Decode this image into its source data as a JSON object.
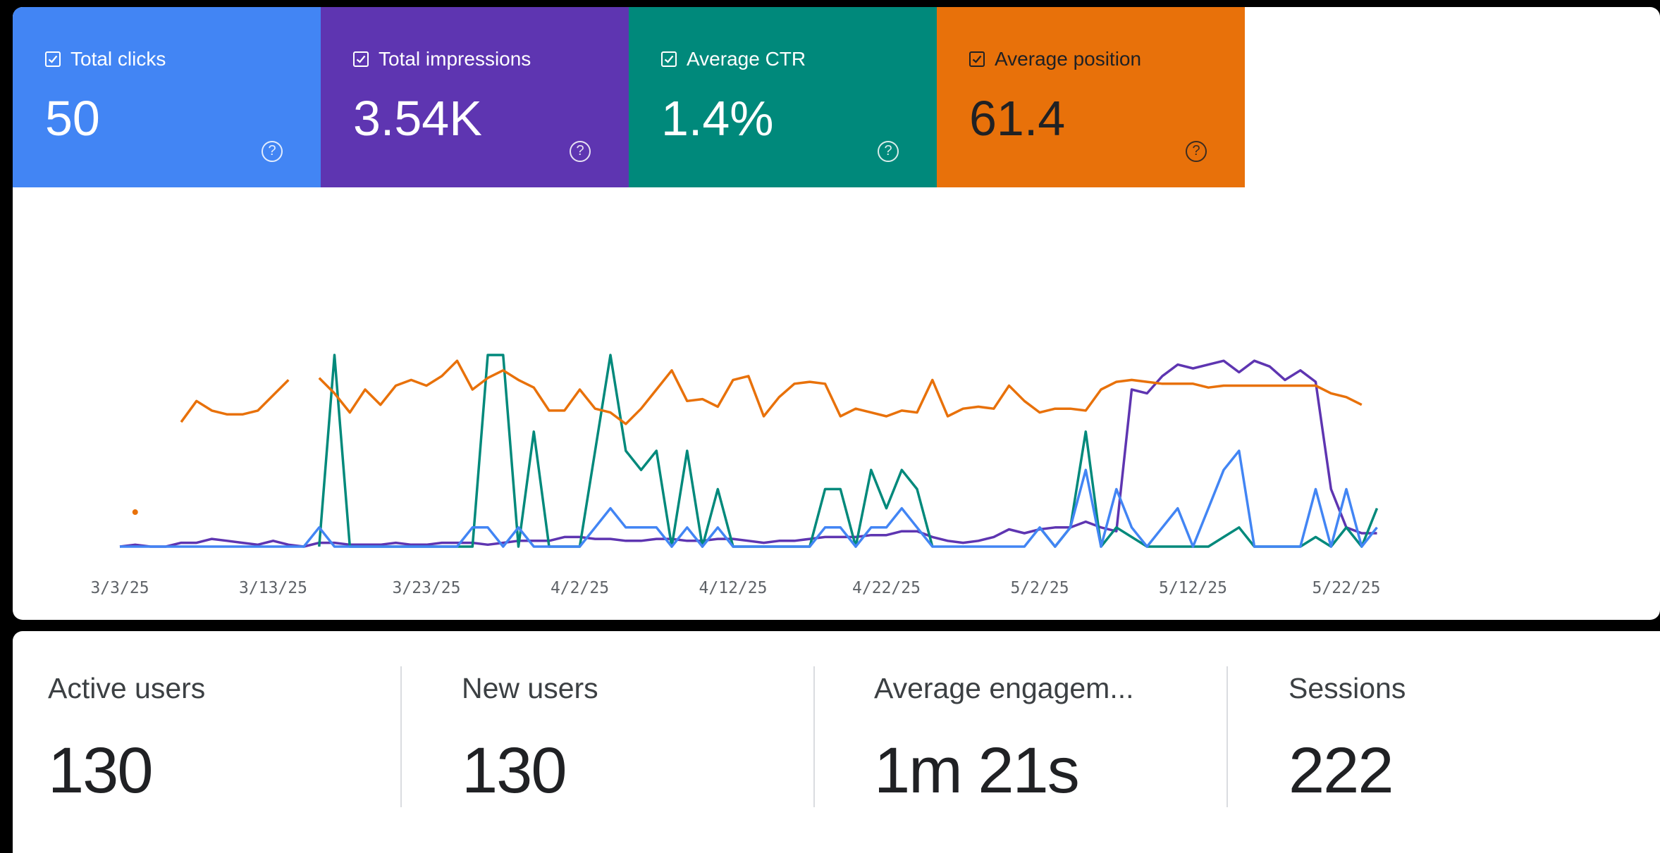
{
  "search_console": {
    "cards": [
      {
        "label": "Total clicks",
        "value": "50",
        "color": "#4285f4",
        "text_color": "#ffffff",
        "checked": true,
        "icon": "help-icon"
      },
      {
        "label": "Total impressions",
        "value": "3.54K",
        "color": "#5e35b1",
        "text_color": "#ffffff",
        "checked": true,
        "icon": "help-icon"
      },
      {
        "label": "Average CTR",
        "value": "1.4%",
        "color": "#00897b",
        "text_color": "#ffffff",
        "checked": true,
        "icon": "help-icon"
      },
      {
        "label": "Average position",
        "value": "61.4",
        "color": "#e8710a",
        "text_color": "#202124",
        "checked": true,
        "icon": "help-icon"
      }
    ]
  },
  "chart_data": {
    "type": "line",
    "x_ticks": [
      "3/3/25",
      "3/13/25",
      "3/23/25",
      "4/2/25",
      "4/12/25",
      "4/22/25",
      "5/2/25",
      "5/12/25",
      "5/22/25"
    ],
    "x_start": "3/3/25",
    "x_end": "5/23/25",
    "grid": false,
    "legend": "none",
    "y_range": [
      0,
      100
    ],
    "series": [
      {
        "key": "clicks",
        "color": "#4285f4",
        "points": [
          [
            0,
            0
          ],
          [
            1,
            0
          ],
          [
            2,
            0
          ],
          [
            3,
            0
          ],
          [
            4,
            0
          ],
          [
            5,
            0
          ],
          [
            6,
            0
          ],
          [
            7,
            0
          ],
          [
            8,
            0
          ],
          [
            9,
            0
          ],
          [
            10,
            0
          ],
          [
            11,
            0
          ],
          [
            12,
            0
          ],
          [
            13,
            10
          ],
          [
            14,
            0
          ],
          [
            15,
            0
          ],
          [
            16,
            0
          ],
          [
            17,
            0
          ],
          [
            18,
            0
          ],
          [
            19,
            0
          ],
          [
            20,
            0
          ],
          [
            21,
            0
          ],
          [
            22,
            0
          ],
          [
            23,
            10
          ],
          [
            24,
            10
          ],
          [
            25,
            0
          ],
          [
            26,
            10
          ],
          [
            27,
            0
          ],
          [
            28,
            0
          ],
          [
            29,
            0
          ],
          [
            30,
            0
          ],
          [
            31,
            10
          ],
          [
            32,
            20
          ],
          [
            33,
            10
          ],
          [
            34,
            10
          ],
          [
            35,
            10
          ],
          [
            36,
            0
          ],
          [
            37,
            10
          ],
          [
            38,
            0
          ],
          [
            39,
            10
          ],
          [
            40,
            0
          ],
          [
            41,
            0
          ],
          [
            42,
            0
          ],
          [
            43,
            0
          ],
          [
            44,
            0
          ],
          [
            45,
            0
          ],
          [
            46,
            10
          ],
          [
            47,
            10
          ],
          [
            48,
            0
          ],
          [
            49,
            10
          ],
          [
            50,
            10
          ],
          [
            51,
            20
          ],
          [
            52,
            10
          ],
          [
            53,
            0
          ],
          [
            54,
            0
          ],
          [
            55,
            0
          ],
          [
            56,
            0
          ],
          [
            57,
            0
          ],
          [
            58,
            0
          ],
          [
            59,
            0
          ],
          [
            60,
            10
          ],
          [
            61,
            0
          ],
          [
            62,
            10
          ],
          [
            63,
            40
          ],
          [
            64,
            0
          ],
          [
            65,
            30
          ],
          [
            66,
            10
          ],
          [
            67,
            0
          ],
          [
            68,
            10
          ],
          [
            69,
            20
          ],
          [
            70,
            0
          ],
          [
            71,
            20
          ],
          [
            72,
            40
          ],
          [
            73,
            50
          ],
          [
            74,
            0
          ],
          [
            75,
            0
          ],
          [
            76,
            0
          ],
          [
            77,
            0
          ],
          [
            78,
            30
          ],
          [
            79,
            0
          ],
          [
            80,
            30
          ],
          [
            81,
            0
          ],
          [
            82,
            10
          ]
        ]
      },
      {
        "key": "impressions",
        "color": "#5e35b1",
        "points": [
          [
            0,
            0
          ],
          [
            1,
            1
          ],
          [
            2,
            0
          ],
          [
            3,
            0
          ],
          [
            4,
            2
          ],
          [
            5,
            2
          ],
          [
            6,
            4
          ],
          [
            7,
            3
          ],
          [
            8,
            2
          ],
          [
            9,
            1
          ],
          [
            10,
            3
          ],
          [
            11,
            1
          ],
          [
            12,
            0
          ],
          [
            13,
            2
          ],
          [
            14,
            2
          ],
          [
            15,
            1
          ],
          [
            16,
            1
          ],
          [
            17,
            1
          ],
          [
            18,
            2
          ],
          [
            19,
            1
          ],
          [
            20,
            1
          ],
          [
            21,
            2
          ],
          [
            22,
            2
          ],
          [
            23,
            2
          ],
          [
            24,
            1
          ],
          [
            25,
            2
          ],
          [
            26,
            3
          ],
          [
            27,
            3
          ],
          [
            28,
            3
          ],
          [
            29,
            5
          ],
          [
            30,
            5
          ],
          [
            31,
            4
          ],
          [
            32,
            4
          ],
          [
            33,
            3
          ],
          [
            34,
            3
          ],
          [
            35,
            4
          ],
          [
            36,
            4
          ],
          [
            37,
            3
          ],
          [
            38,
            3
          ],
          [
            39,
            4
          ],
          [
            40,
            4
          ],
          [
            41,
            3
          ],
          [
            42,
            2
          ],
          [
            43,
            3
          ],
          [
            44,
            3
          ],
          [
            45,
            4
          ],
          [
            46,
            5
          ],
          [
            47,
            5
          ],
          [
            48,
            5
          ],
          [
            49,
            6
          ],
          [
            50,
            6
          ],
          [
            51,
            8
          ],
          [
            52,
            8
          ],
          [
            53,
            5
          ],
          [
            54,
            3
          ],
          [
            55,
            2
          ],
          [
            56,
            3
          ],
          [
            57,
            5
          ],
          [
            58,
            9
          ],
          [
            59,
            7
          ],
          [
            60,
            9
          ],
          [
            61,
            10
          ],
          [
            62,
            10
          ],
          [
            63,
            13
          ],
          [
            64,
            10
          ],
          [
            65,
            8
          ],
          [
            66,
            82
          ],
          [
            67,
            80
          ],
          [
            68,
            89
          ],
          [
            69,
            95
          ],
          [
            70,
            93
          ],
          [
            71,
            95
          ],
          [
            72,
            97
          ],
          [
            73,
            91
          ],
          [
            74,
            97
          ],
          [
            75,
            94
          ],
          [
            76,
            87
          ],
          [
            77,
            92
          ],
          [
            78,
            86
          ],
          [
            79,
            30
          ],
          [
            80,
            10
          ],
          [
            81,
            7
          ],
          [
            82,
            7
          ]
        ]
      },
      {
        "key": "ctr",
        "color": "#00897b",
        "points": [
          [
            13,
            0
          ],
          [
            14,
            100
          ],
          [
            15,
            0
          ],
          [
            16,
            0
          ],
          [
            17,
            0
          ],
          [
            18,
            0
          ],
          [
            19,
            0
          ],
          [
            20,
            0
          ],
          [
            21,
            0
          ],
          [
            22,
            0
          ],
          [
            23,
            0
          ],
          [
            24,
            100
          ],
          [
            25,
            100
          ],
          [
            26,
            0
          ],
          [
            27,
            60
          ],
          [
            28,
            0
          ],
          [
            29,
            0
          ],
          [
            30,
            0
          ],
          [
            31,
            50
          ],
          [
            32,
            100
          ],
          [
            33,
            50
          ],
          [
            34,
            40
          ],
          [
            35,
            50
          ],
          [
            36,
            0
          ],
          [
            37,
            50
          ],
          [
            38,
            0
          ],
          [
            39,
            30
          ],
          [
            40,
            0
          ],
          [
            41,
            0
          ],
          [
            42,
            0
          ],
          [
            43,
            0
          ],
          [
            44,
            0
          ],
          [
            45,
            0
          ],
          [
            46,
            30
          ],
          [
            47,
            30
          ],
          [
            48,
            0
          ],
          [
            49,
            40
          ],
          [
            50,
            20
          ],
          [
            51,
            40
          ],
          [
            52,
            30
          ],
          [
            53,
            0
          ],
          [
            60,
            10
          ],
          [
            61,
            0
          ],
          [
            62,
            10
          ],
          [
            63,
            60
          ],
          [
            64,
            0
          ],
          [
            65,
            10
          ],
          [
            66,
            5
          ],
          [
            67,
            0
          ],
          [
            68,
            0
          ],
          [
            69,
            0
          ],
          [
            70,
            0
          ],
          [
            71,
            0
          ],
          [
            72,
            5
          ],
          [
            73,
            10
          ],
          [
            74,
            0
          ],
          [
            75,
            0
          ],
          [
            76,
            0
          ],
          [
            77,
            0
          ],
          [
            78,
            5
          ],
          [
            79,
            0
          ],
          [
            80,
            10
          ],
          [
            81,
            0
          ],
          [
            82,
            20
          ]
        ]
      },
      {
        "key": "position",
        "color": "#e8710a",
        "points": [
          [
            1,
            18
          ],
          [
            4,
            65
          ],
          [
            5,
            76
          ],
          [
            6,
            71
          ],
          [
            7,
            69
          ],
          [
            8,
            69
          ],
          [
            9,
            71
          ],
          [
            10,
            79
          ],
          [
            11,
            87
          ],
          [
            13,
            88
          ],
          [
            14,
            80
          ],
          [
            15,
            70
          ],
          [
            16,
            82
          ],
          [
            17,
            74
          ],
          [
            18,
            84
          ],
          [
            19,
            87
          ],
          [
            20,
            84
          ],
          [
            21,
            89
          ],
          [
            22,
            97
          ],
          [
            23,
            82
          ],
          [
            24,
            88
          ],
          [
            25,
            92
          ],
          [
            26,
            87
          ],
          [
            27,
            83
          ],
          [
            28,
            71
          ],
          [
            29,
            71
          ],
          [
            30,
            82
          ],
          [
            31,
            72
          ],
          [
            32,
            70
          ],
          [
            33,
            64
          ],
          [
            34,
            72
          ],
          [
            35,
            82
          ],
          [
            36,
            92
          ],
          [
            37,
            76
          ],
          [
            38,
            77
          ],
          [
            39,
            73
          ],
          [
            40,
            87
          ],
          [
            41,
            89
          ],
          [
            42,
            68
          ],
          [
            43,
            78
          ],
          [
            44,
            85
          ],
          [
            45,
            86
          ],
          [
            46,
            85
          ],
          [
            47,
            68
          ],
          [
            48,
            72
          ],
          [
            49,
            70
          ],
          [
            50,
            68
          ],
          [
            51,
            71
          ],
          [
            52,
            70
          ],
          [
            53,
            87
          ],
          [
            54,
            68
          ],
          [
            55,
            72
          ],
          [
            56,
            73
          ],
          [
            57,
            72
          ],
          [
            58,
            84
          ],
          [
            59,
            76
          ],
          [
            60,
            70
          ],
          [
            61,
            72
          ],
          [
            62,
            72
          ],
          [
            63,
            71
          ],
          [
            64,
            82
          ],
          [
            65,
            86
          ],
          [
            66,
            87
          ],
          [
            67,
            86
          ],
          [
            68,
            85
          ],
          [
            69,
            85
          ],
          [
            70,
            85
          ],
          [
            71,
            83
          ],
          [
            72,
            84
          ],
          [
            73,
            84
          ],
          [
            74,
            84
          ],
          [
            75,
            84
          ],
          [
            76,
            84
          ],
          [
            77,
            84
          ],
          [
            78,
            84
          ],
          [
            79,
            80
          ],
          [
            80,
            78
          ],
          [
            81,
            74
          ]
        ]
      }
    ]
  },
  "analytics": {
    "metrics": [
      {
        "label": "Active users",
        "value": "130"
      },
      {
        "label": "New users",
        "value": "130"
      },
      {
        "label": "Average engagem...",
        "value": "1m 21s"
      },
      {
        "label": "Sessions",
        "value": "222"
      }
    ]
  }
}
